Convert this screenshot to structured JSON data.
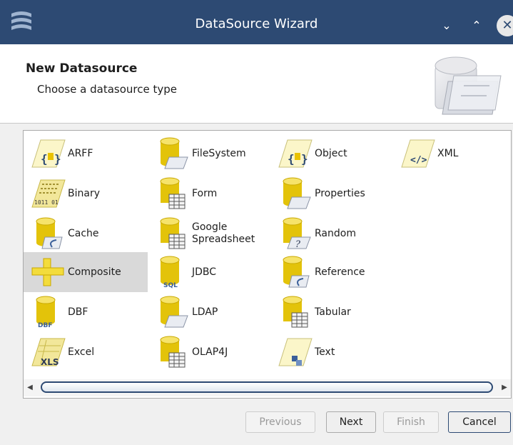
{
  "window": {
    "title": "DataSource Wizard",
    "minimize_glyph": "⌄",
    "maximize_glyph": "⌃",
    "close_glyph": "✕"
  },
  "header": {
    "title": "New Datasource",
    "subtitle": "Choose a datasource type"
  },
  "datasource_types": {
    "arff": "ARFF",
    "binary": "Binary",
    "cache": "Cache",
    "composite": "Composite",
    "dbf": "DBF",
    "excel": "Excel",
    "filesystem": "FileSystem",
    "form": "Form",
    "google_spreadsheet_line1": "Google",
    "google_spreadsheet_line2": "Spreadsheet",
    "jdbc": "JDBC",
    "ldap": "LDAP",
    "olap4j": "OLAP4J",
    "object": "Object",
    "properties": "Properties",
    "random": "Random",
    "reference": "Reference",
    "tabular": "Tabular",
    "text": "Text",
    "xml": "XML",
    "selected": "Composite"
  },
  "icon_text": {
    "binary_bits": "1011 01",
    "dbf": "DBF",
    "sql": "SQL",
    "xls": "XLS",
    "xml_tag": "</>"
  },
  "buttons": {
    "previous": "Previous",
    "next": "Next",
    "finish": "Finish",
    "cancel": "Cancel"
  },
  "colors": {
    "titlebar": "#2d4a73",
    "selection": "#d9d9d9",
    "cylinder": "#e3c30a",
    "folder": "#e9ecf2"
  }
}
